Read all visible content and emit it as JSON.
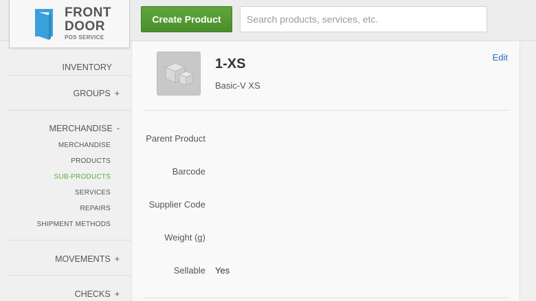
{
  "logo": {
    "line1": "FRONT",
    "line2": "DOOR",
    "line3": "POS SERVICE"
  },
  "toolbar": {
    "create_label": "Create Product",
    "search_placeholder": "Search products, services, etc.",
    "search_value": ""
  },
  "sidebar": {
    "inventory": "INVENTORY",
    "groups": {
      "label": "GROUPS",
      "toggle": "+"
    },
    "merchandise": {
      "label": "MERCHANDISE",
      "toggle": "-",
      "items": [
        "MERCHANDISE",
        "PRODUCTS",
        "SUB-PRODUCTS",
        "SERVICES",
        "REPAIRS",
        "SHIPMENT METHODS"
      ],
      "active": "SUB-PRODUCTS"
    },
    "movements": {
      "label": "MOVEMENTS",
      "toggle": "+"
    },
    "checks": {
      "label": "CHECKS",
      "toggle": "+"
    }
  },
  "product": {
    "title": "1-XS",
    "subtitle": "Basic-V XS",
    "edit_label": "Edit",
    "image_icon": "product-boxes-icon",
    "fields": [
      {
        "label": "Parent Product",
        "value": ""
      },
      {
        "label": "Barcode",
        "value": ""
      },
      {
        "label": "Supplier Code",
        "value": ""
      },
      {
        "label": "Weight (g)",
        "value": ""
      },
      {
        "label": "Sellable",
        "value": "Yes"
      }
    ]
  },
  "colors": {
    "accent_green": "#4f9a2f",
    "active_nav": "#5cae3c",
    "link_blue": "#2a6fb6",
    "logo_blue": "#3aa0dc"
  }
}
